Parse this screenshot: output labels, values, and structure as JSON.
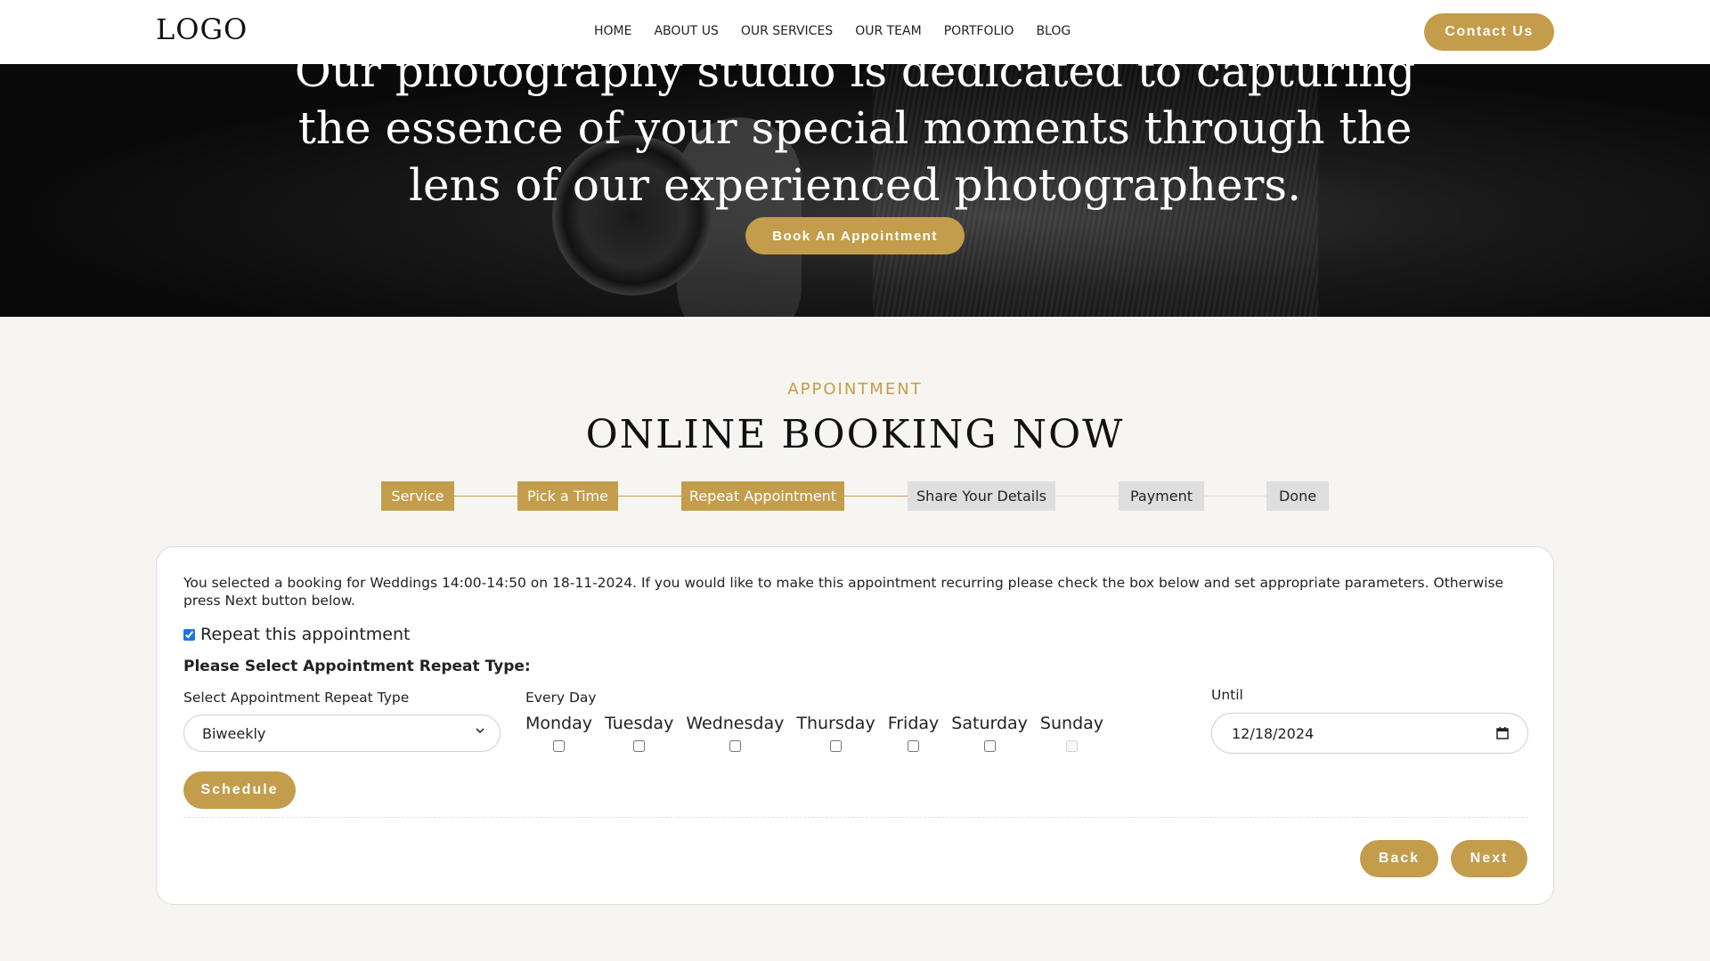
{
  "header": {
    "logo": "LOGO",
    "nav": [
      "HOME",
      "ABOUT US",
      "OUR SERVICES",
      "OUR TEAM",
      "PORTFOLIO",
      "BLOG"
    ],
    "contact_label": "Contact Us"
  },
  "hero": {
    "text_line1": "Our photography studio is dedicated to capturing",
    "text_line2": "the essence of your special moments through the",
    "text_line3": "lens of our experienced photographers.",
    "cta_label": "Book An Appointment"
  },
  "section": {
    "eyebrow": "APPOINTMENT",
    "title": "ONLINE BOOKING NOW"
  },
  "steps": [
    {
      "label": "Service",
      "active": true
    },
    {
      "label": "Pick a Time",
      "active": true
    },
    {
      "label": "Repeat Appointment",
      "active": true
    },
    {
      "label": "Share Your Details",
      "active": false
    },
    {
      "label": "Payment",
      "active": false
    },
    {
      "label": "Done",
      "active": false
    }
  ],
  "form": {
    "info": "You selected a booking for Weddings 14:00-14:50 on 18-11-2024. If you would like to make this appointment recurring please check the box below and set appropriate parameters. Otherwise press Next button below.",
    "repeat_label": "Repeat this appointment",
    "repeat_checked": true,
    "heading": "Please Select Appointment Repeat Type:",
    "type_label": "Select Appointment Repeat Type",
    "type_value": "Biweekly",
    "every_day_label": "Every Day",
    "days": [
      "Monday",
      "Tuesday",
      "Wednesday",
      "Thursday",
      "Friday",
      "Saturday",
      "Sunday"
    ],
    "until_label": "Until",
    "until_value": "12/18/2024",
    "schedule_label": "Schedule",
    "back_label": "Back",
    "next_label": "Next"
  },
  "colors": {
    "accent": "#c39d4b",
    "step_inactive": "#dedede",
    "page_bg": "#f7f5f1"
  }
}
